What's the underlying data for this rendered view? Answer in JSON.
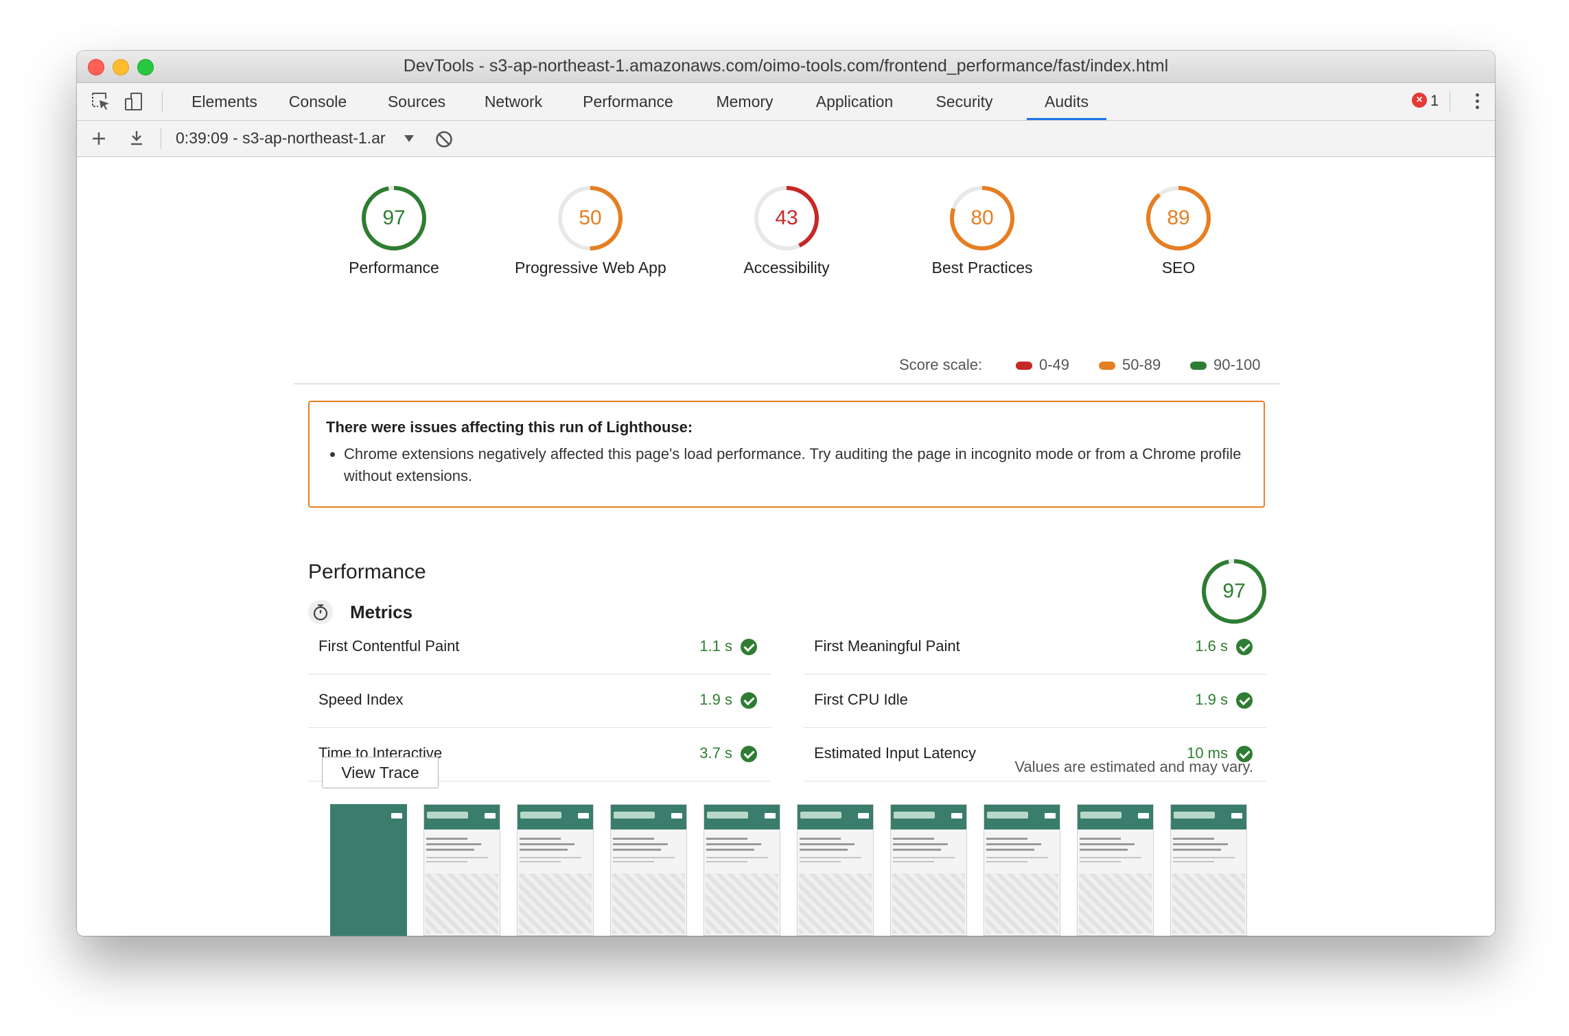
{
  "window": {
    "title": "DevTools - s3-ap-northeast-1.amazonaws.com/oimo-tools.com/frontend_performance/fast/index.html"
  },
  "tabs": [
    {
      "label": "Elements"
    },
    {
      "label": "Console"
    },
    {
      "label": "Sources"
    },
    {
      "label": "Network"
    },
    {
      "label": "Performance"
    },
    {
      "label": "Memory"
    },
    {
      "label": "Application"
    },
    {
      "label": "Security"
    },
    {
      "label": "Audits"
    }
  ],
  "active_tab": "Audits",
  "error_count": "1",
  "toolbar": {
    "report_selector": "0:39:09 - s3-ap-northeast-1.ar"
  },
  "scores": [
    {
      "value": 97,
      "label": "Performance",
      "color": "#2e7d32"
    },
    {
      "value": 50,
      "label": "Progressive Web App",
      "color": "#e67e22"
    },
    {
      "value": 43,
      "label": "Accessibility",
      "color": "#c62828"
    },
    {
      "value": 80,
      "label": "Best Practices",
      "color": "#e67e22"
    },
    {
      "value": 89,
      "label": "SEO",
      "color": "#e67e22"
    }
  ],
  "score_scale": {
    "label": "Score scale:",
    "ranges": [
      {
        "range": "0-49",
        "color": "#c62828"
      },
      {
        "range": "50-89",
        "color": "#e67e22"
      },
      {
        "range": "90-100",
        "color": "#2e7d32"
      }
    ]
  },
  "warning": {
    "title": "There were issues affecting this run of Lighthouse:",
    "item": "Chrome extensions negatively affected this page's load performance. Try auditing the page in incognito mode or from a Chrome profile without extensions."
  },
  "performance": {
    "title": "Performance",
    "score": 97,
    "metrics_title": "Metrics",
    "metrics": [
      {
        "name": "First Contentful Paint",
        "value": "1.1 s"
      },
      {
        "name": "First Meaningful Paint",
        "value": "1.6 s"
      },
      {
        "name": "Speed Index",
        "value": "1.9 s"
      },
      {
        "name": "First CPU Idle",
        "value": "1.9 s"
      },
      {
        "name": "Time to Interactive",
        "value": "3.7 s"
      },
      {
        "name": "Estimated Input Latency",
        "value": "10 ms"
      }
    ],
    "view_trace_label": "View Trace",
    "estimate_note": "Values are estimated and may vary.",
    "filmstrip_count": 10
  }
}
